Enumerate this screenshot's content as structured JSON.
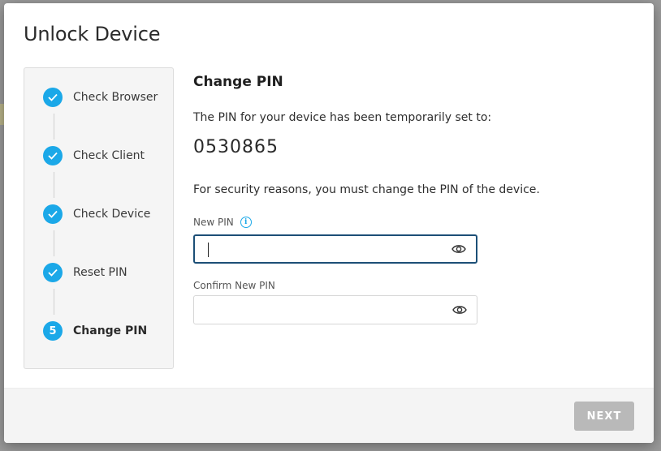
{
  "dialog": {
    "title": "Unlock Device"
  },
  "stepper": {
    "steps": [
      {
        "label": "Check Browser",
        "state": "complete",
        "icon": "check-icon"
      },
      {
        "label": "Check Client",
        "state": "complete",
        "icon": "check-icon"
      },
      {
        "label": "Check Device",
        "state": "complete",
        "icon": "check-icon"
      },
      {
        "label": "Reset PIN",
        "state": "complete",
        "icon": "check-icon"
      },
      {
        "label": "Change PIN",
        "state": "active",
        "number": "5"
      }
    ]
  },
  "content": {
    "heading": "Change PIN",
    "pin_intro": "The PIN for your device has been temporarily set to:",
    "temporary_pin": "0530865",
    "security_text": "For security reasons, you must change the PIN of the device.",
    "new_pin": {
      "label": "New PIN",
      "value": "",
      "info_icon": "info-icon",
      "toggle_icon": "eye-icon"
    },
    "confirm_pin": {
      "label": "Confirm New PIN",
      "value": "",
      "toggle_icon": "eye-icon"
    }
  },
  "footer": {
    "next_label": "NEXT"
  },
  "colors": {
    "accent": "#1ba8e8",
    "focus_border": "#1c4f77",
    "disabled_button": "#b9b9b9"
  }
}
